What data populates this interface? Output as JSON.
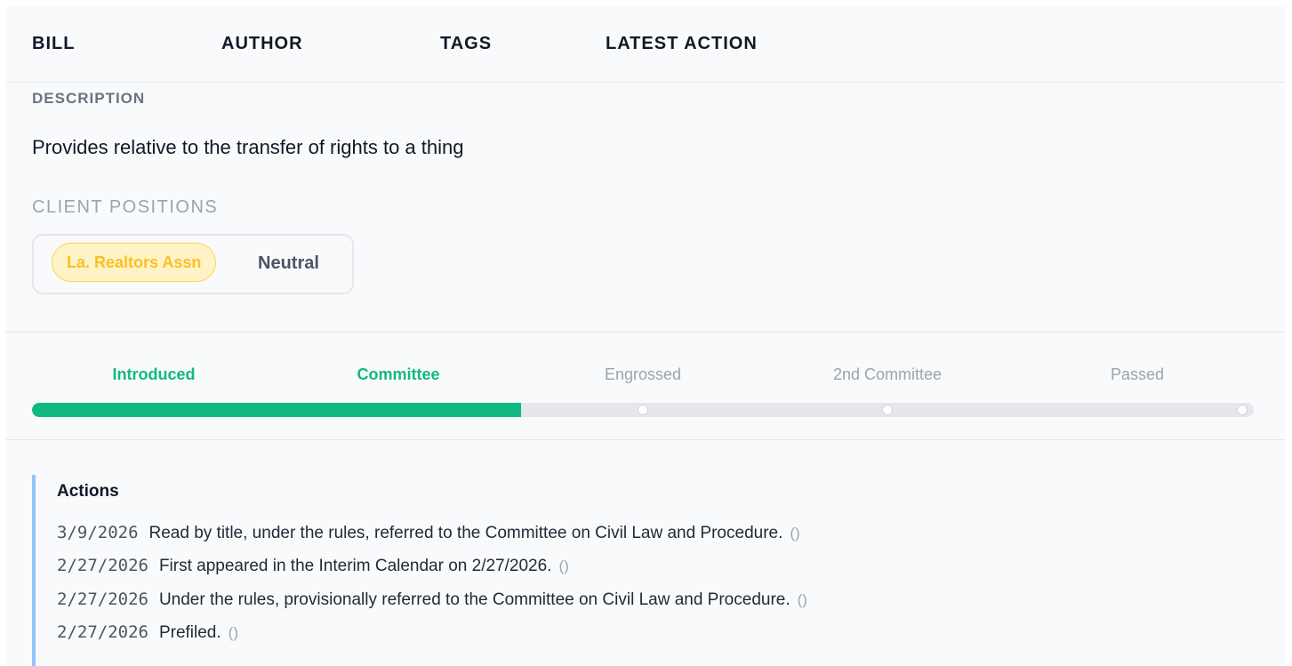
{
  "header": {
    "columns": [
      "BILL",
      "AUTHOR",
      "TAGS",
      "LATEST ACTION"
    ]
  },
  "description": {
    "label": "DESCRIPTION",
    "text": "Provides relative to the transfer of rights to a thing"
  },
  "client_positions": {
    "label": "CLIENT POSITIONS",
    "items": [
      {
        "client": "La. Realtors Assn",
        "position": "Neutral"
      }
    ]
  },
  "progress": {
    "stages": [
      {
        "label": "Introduced",
        "status": "done"
      },
      {
        "label": "Committee",
        "status": "done"
      },
      {
        "label": "Engrossed",
        "status": "todo"
      },
      {
        "label": "2nd Committee",
        "status": "todo"
      },
      {
        "label": "Passed",
        "status": "todo"
      }
    ],
    "completed_fraction": 0.4,
    "colors": {
      "done": "#10b981",
      "todo": "#9ca3af",
      "track": "#e5e7eb"
    }
  },
  "actions": {
    "title": "Actions",
    "items": [
      {
        "date": "3/9/2026",
        "text": "Read by title, under the rules, referred to the Committee on Civil Law and Procedure.",
        "link": "()"
      },
      {
        "date": "2/27/2026",
        "text": "First appeared in the Interim Calendar on 2/27/2026.",
        "link": "()"
      },
      {
        "date": "2/27/2026",
        "text": "Under the rules, provisionally referred to the Committee on Civil Law and Procedure.",
        "link": "()"
      },
      {
        "date": "2/27/2026",
        "text": "Prefiled.",
        "link": "()"
      }
    ]
  },
  "colors": {
    "client_pill_bg": "#fef3c7",
    "client_pill_text": "#fbbf24",
    "actions_border": "#93c5fd"
  }
}
